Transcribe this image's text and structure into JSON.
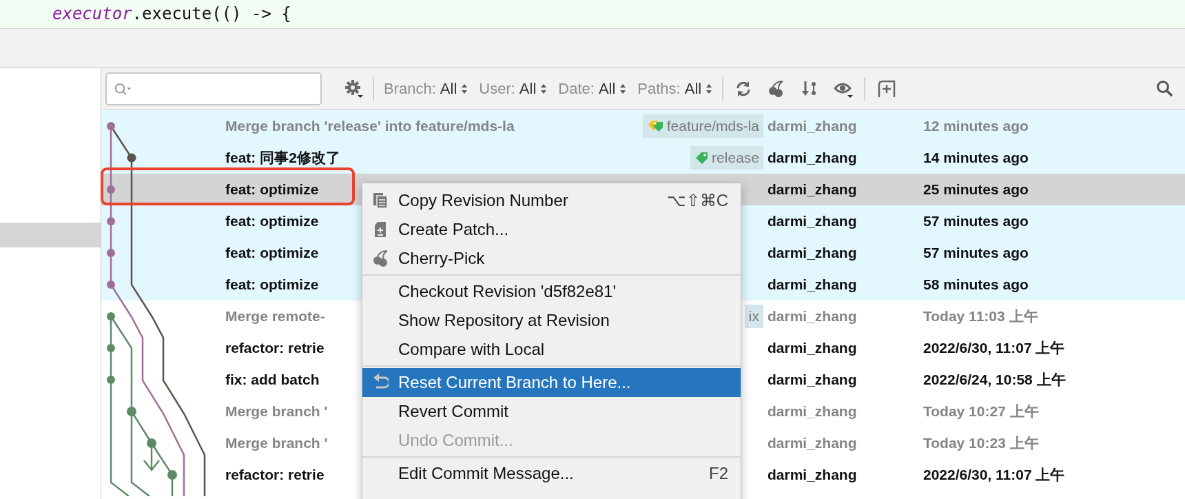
{
  "editor": {
    "code_keyword": "executor",
    "code_rest": ".execute(() -> {"
  },
  "toolbar": {
    "filters": [
      {
        "label": "Branch:",
        "value": "All"
      },
      {
        "label": "User:",
        "value": "All"
      },
      {
        "label": "Date:",
        "value": "All"
      },
      {
        "label": "Paths:",
        "value": "All"
      }
    ]
  },
  "commits": [
    {
      "kind": "merge",
      "subject": "Merge branch 'release' into feature/mds-la",
      "tag": {
        "label": "feature/mds-la",
        "kind": "both"
      },
      "author": "darmi_zhang",
      "date": "12 minutes ago",
      "highlighted": true,
      "selected": false
    },
    {
      "kind": "commit",
      "subject": "feat: 同事2修改了",
      "tag": {
        "label": "release",
        "kind": "remote"
      },
      "author": "darmi_zhang",
      "date": "14 minutes ago",
      "highlighted": true,
      "selected": false
    },
    {
      "kind": "commit",
      "subject": "feat: optimize",
      "author": "darmi_zhang",
      "date": "25 minutes ago",
      "highlighted": true,
      "selected": true
    },
    {
      "kind": "commit",
      "subject": "feat: optimize",
      "author": "darmi_zhang",
      "date": "57 minutes ago",
      "highlighted": true,
      "selected": false
    },
    {
      "kind": "commit",
      "subject": "feat: optimize",
      "author": "darmi_zhang",
      "date": "57 minutes ago",
      "highlighted": true,
      "selected": false
    },
    {
      "kind": "commit",
      "subject": "feat: optimize",
      "author": "darmi_zhang",
      "date": "58 minutes ago",
      "highlighted": true,
      "selected": false
    },
    {
      "kind": "merge",
      "subject": "Merge remote-",
      "tag": {
        "label": "ix",
        "kind": "none"
      },
      "author": "darmi_zhang",
      "date": "Today 11:03 上午",
      "highlighted": false,
      "selected": false
    },
    {
      "kind": "commit",
      "subject": "refactor: retrie",
      "author": "darmi_zhang",
      "date": "2022/6/30, 11:07 上午",
      "highlighted": false,
      "selected": false
    },
    {
      "kind": "commit",
      "subject": "fix: add batch",
      "author": "darmi_zhang",
      "date": "2022/6/24, 10:58 上午",
      "highlighted": false,
      "selected": false
    },
    {
      "kind": "merge",
      "subject": "Merge branch '",
      "author": "darmi_zhang",
      "date": "Today 10:27 上午",
      "highlighted": false,
      "selected": false
    },
    {
      "kind": "merge",
      "subject": "Merge branch '",
      "author": "darmi_zhang",
      "date": "Today 10:23 上午",
      "highlighted": false,
      "selected": false
    },
    {
      "kind": "commit",
      "subject": "refactor: retrie",
      "author": "darmi_zhang",
      "date": "2022/6/30, 11:07 上午",
      "highlighted": false,
      "selected": false
    }
  ],
  "context_menu": {
    "items": [
      {
        "kind": "item",
        "label": "Copy Revision Number",
        "shortcut": "⌥⇧⌘C",
        "selected": false,
        "disabled": false
      },
      {
        "kind": "item",
        "label": "Create Patch...",
        "selected": false,
        "disabled": false
      },
      {
        "kind": "item",
        "label": "Cherry-Pick",
        "selected": false,
        "disabled": false
      },
      {
        "kind": "separator"
      },
      {
        "kind": "item",
        "label": "Checkout Revision 'd5f82e81'",
        "selected": false,
        "disabled": false
      },
      {
        "kind": "item",
        "label": "Show Repository at Revision",
        "selected": false,
        "disabled": false
      },
      {
        "kind": "item",
        "label": "Compare with Local",
        "selected": false,
        "disabled": false
      },
      {
        "kind": "separator"
      },
      {
        "kind": "item",
        "label": "Reset Current Branch to Here...",
        "selected": true,
        "disabled": false
      },
      {
        "kind": "item",
        "label": "Revert Commit",
        "selected": false,
        "disabled": false
      },
      {
        "kind": "item",
        "label": "Undo Commit...",
        "selected": false,
        "disabled": true
      },
      {
        "kind": "separator"
      },
      {
        "kind": "item",
        "label": "Edit Commit Message...",
        "shortcut": "F2",
        "selected": false,
        "disabled": false
      }
    ]
  }
}
